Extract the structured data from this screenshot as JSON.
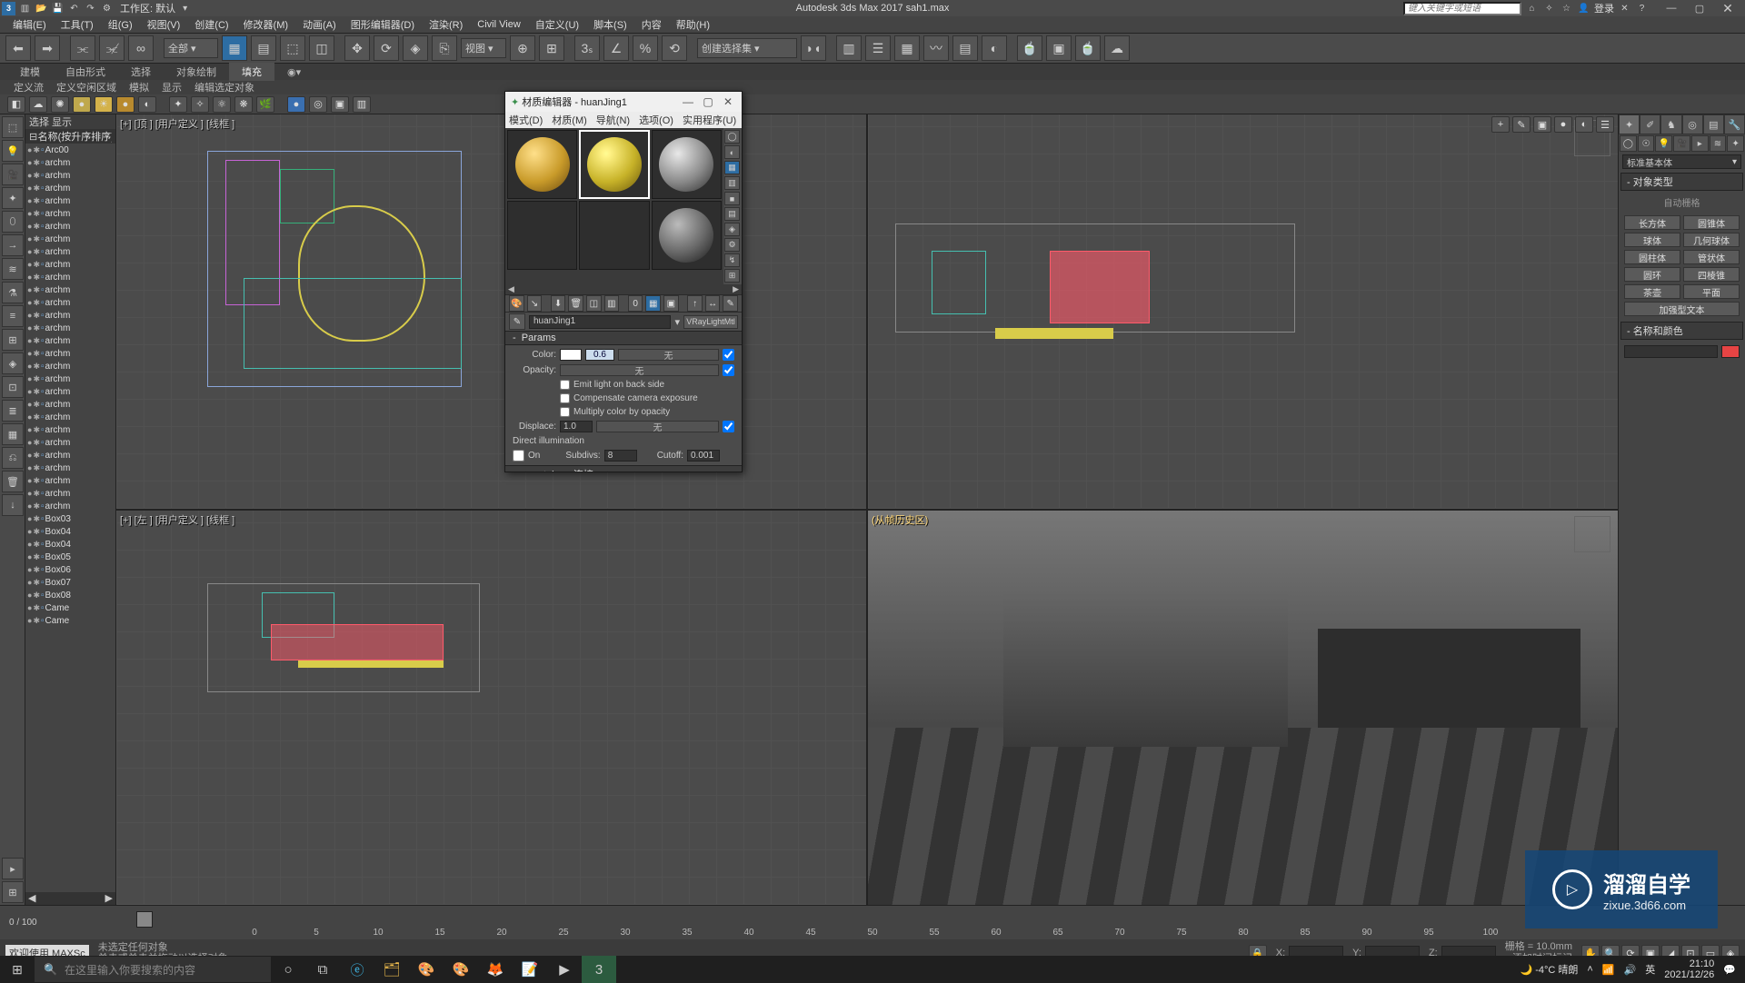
{
  "app": {
    "title": "Autodesk 3ds Max 2017    sah1.max",
    "workspace_label": "工作区: 默认",
    "search_placeholder": "键入关键字或短语",
    "login": "登录"
  },
  "menus": [
    "编辑(E)",
    "工具(T)",
    "组(G)",
    "视图(V)",
    "创建(C)",
    "修改器(M)",
    "动画(A)",
    "图形编辑器(D)",
    "渲染(R)",
    "Civil View",
    "自定义(U)",
    "脚本(S)",
    "内容",
    "帮助(H)"
  ],
  "toolbar_dropdowns": {
    "all": "全部 ▾",
    "view": "视图 ▾",
    "create_sel": "创建选择集 ▾"
  },
  "ribbon_tabs": [
    "建模",
    "自由形式",
    "选择",
    "对象绘制",
    "填充"
  ],
  "sub_tabs": [
    "定义流",
    "定义空闲区域",
    "模拟",
    "显示",
    "编辑选定对象"
  ],
  "scene_explorer": {
    "header": "选择    显示",
    "title": "名称(按升序排序)",
    "items": [
      "Arc00",
      "archm",
      "archm",
      "archm",
      "archm",
      "archm",
      "archm",
      "archm",
      "archm",
      "archm",
      "archm",
      "archm",
      "archm",
      "archm",
      "archm",
      "archm",
      "archm",
      "archm",
      "archm",
      "archm",
      "archm",
      "archm",
      "archm",
      "archm",
      "archm",
      "archm",
      "archm",
      "archm",
      "archm",
      "Box03",
      "Box04",
      "Box04",
      "Box05",
      "Box06",
      "Box07",
      "Box08",
      "Came",
      "Came"
    ]
  },
  "viewport_labels": {
    "tl": "[+] [顶 ] [用户定义 ] [线框 ]",
    "tr": "",
    "bl": "[+] [左 ] [用户定义 ] [线框 ]",
    "br": "(从帧历史区)"
  },
  "command_panel": {
    "dropdown": "标准基本体",
    "roll1": "对象类型",
    "auto_grid": "自动栅格",
    "btns": [
      "长方体",
      "圆锥体",
      "球体",
      "几何球体",
      "圆柱体",
      "管状体",
      "圆环",
      "四棱锥",
      "茶壶",
      "平面",
      "加强型文本"
    ],
    "roll2": "名称和颜色"
  },
  "timeline": {
    "range": "0 / 100",
    "ticks": [
      0,
      5,
      10,
      15,
      20,
      25,
      30,
      35,
      40,
      45,
      50,
      55,
      60,
      65,
      70,
      75,
      80,
      85,
      90,
      95,
      100
    ]
  },
  "status": {
    "welcome": "欢迎使用 MAXSc",
    "hint1": "未选定任何对象",
    "hint2": "单击或单击并拖动以选择对象",
    "grid": "栅格 = 10.0mm",
    "add_marker": "添加时间标记",
    "coords": {
      "x": "X:",
      "y": "Y:",
      "z": "Z:"
    }
  },
  "taskbar": {
    "search_placeholder": "在这里输入你要搜索的内容",
    "weather": "-4°C 晴朗",
    "time": "21:10",
    "date": "2021/12/26"
  },
  "material_editor": {
    "title": "材质编辑器 - huanJing1",
    "menus": [
      "模式(D)",
      "材质(M)",
      "导航(N)",
      "选项(O)",
      "实用程序(U)"
    ],
    "name": "huanJing1",
    "type": "VRayLightMtl",
    "rollouts": {
      "params": "Params",
      "mr": "mental ray 连接"
    },
    "params": {
      "color_lbl": "Color:",
      "color_val": "0.6",
      "none": "无",
      "opacity_lbl": "Opacity:",
      "emit_back": "Emit light on back side",
      "comp_exp": "Compensate camera exposure",
      "mult_opac": "Multiply color by opacity",
      "displace_lbl": "Displace:",
      "displace_val": "1.0",
      "direct": "Direct illumination",
      "on": "On",
      "subdivs_lbl": "Subdivs:",
      "subdivs_val": "8",
      "cutoff_lbl": "Cutoff:",
      "cutoff_val": "0.001"
    }
  },
  "watermark": {
    "brand": "溜溜自学",
    "sub": "zixue.3d66.com"
  }
}
